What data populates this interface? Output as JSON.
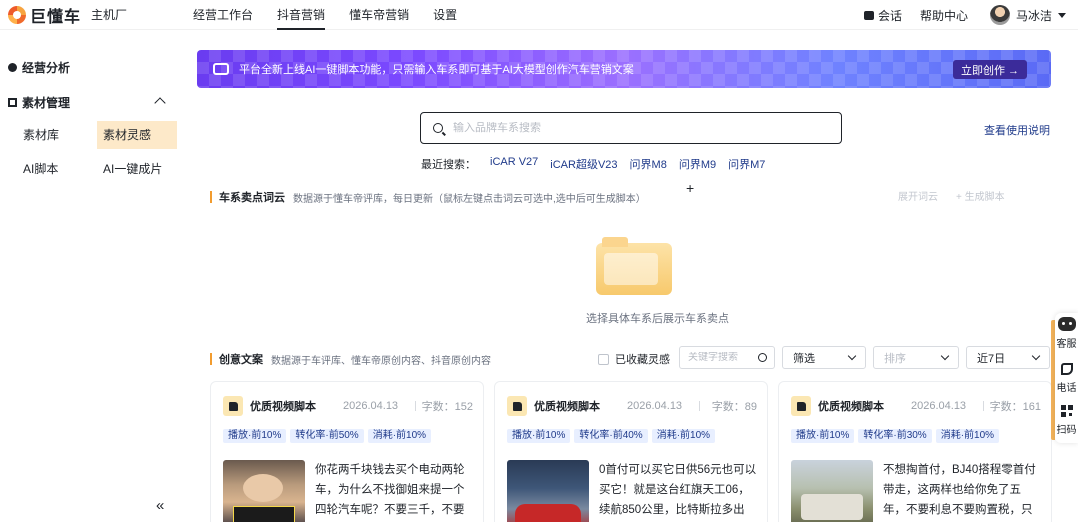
{
  "header": {
    "logo_text": "巨懂车",
    "sub_brand": "主机厂",
    "nav": [
      {
        "label": "经营工作台",
        "active": false
      },
      {
        "label": "抖音营销",
        "active": true
      },
      {
        "label": "懂车帝营销",
        "active": false
      },
      {
        "label": "设置",
        "active": false
      }
    ],
    "chat_label": "会话",
    "help_label": "帮助中心",
    "user_name": "马冰洁"
  },
  "sidebar": {
    "section1": "经营分析",
    "section2": "素材管理",
    "items": [
      "素材库",
      "素材灵感",
      "AI脚本",
      "AI一键成片"
    ],
    "active_item": "素材灵感"
  },
  "banner": {
    "text": "平台全新上线AI一键脚本功能，只需输入车系即可基于AI大模型创作汽车营销文案",
    "button": "立即创作 →"
  },
  "search": {
    "placeholder": "输入品牌车系搜索",
    "guide_link": "查看使用说明",
    "recent_label": "最近搜索：",
    "recent": [
      "iCAR V27",
      "iCAR超级V23",
      "问界M8",
      "问界M9",
      "问界M7"
    ]
  },
  "word_cloud": {
    "title": "车系卖点词云",
    "desc": "数据源于懂车帝评库，每日更新（鼠标左键点击词云可选中,选中后可生成脚本）",
    "action1": "展开词云",
    "action2": "+ 生成脚本",
    "empty_text": "选择具体车系后展示车系卖点"
  },
  "creative": {
    "title": "创意文案",
    "desc": "数据源于车评库、懂车帝原创内容、抖音原创内容",
    "fav_label": "已收藏灵感",
    "keyword_placeholder": "关键字搜索",
    "filter_label": "筛选",
    "sort_placeholder": "排序",
    "period_label": "近7日"
  },
  "cards": [
    {
      "title": "优质视频脚本",
      "date": "2026.04.13",
      "count": "字数：152",
      "tags": [
        "播放·前10%",
        "转化率·前50%",
        "消耗·前10%"
      ],
      "text": "你花两千块钱去买个电动两轮车，为什么不找御姐来提一个四轮汽车呢？不要三千，不要"
    },
    {
      "title": "优质视频脚本",
      "date": "2026.04.13",
      "count": "字数：89",
      "tags": [
        "播放·前10%",
        "转化率·前40%",
        "消耗·前10%"
      ],
      "text": "0首付可以买它日供56元也可以买它！就是这台红旗天工06，续航850公里，比特斯拉多出"
    },
    {
      "title": "优质视频脚本",
      "date": "2026.04.13",
      "count": "字数：161",
      "tags": [
        "播放·前10%",
        "转化率·前30%",
        "消耗·前10%"
      ],
      "text": "不想掏首付，BJ40搭程零首付带走，这两样也给你免了五年，不要利息不要购置税，只"
    }
  ],
  "float_tools": [
    "客服",
    "电话",
    "扫码"
  ],
  "colors": {
    "accent_orange": "#f29c2f",
    "link_blue": "#1f3a8a",
    "banner_purple": "#7b49ff",
    "active_item_bg": "#fde9c9"
  }
}
